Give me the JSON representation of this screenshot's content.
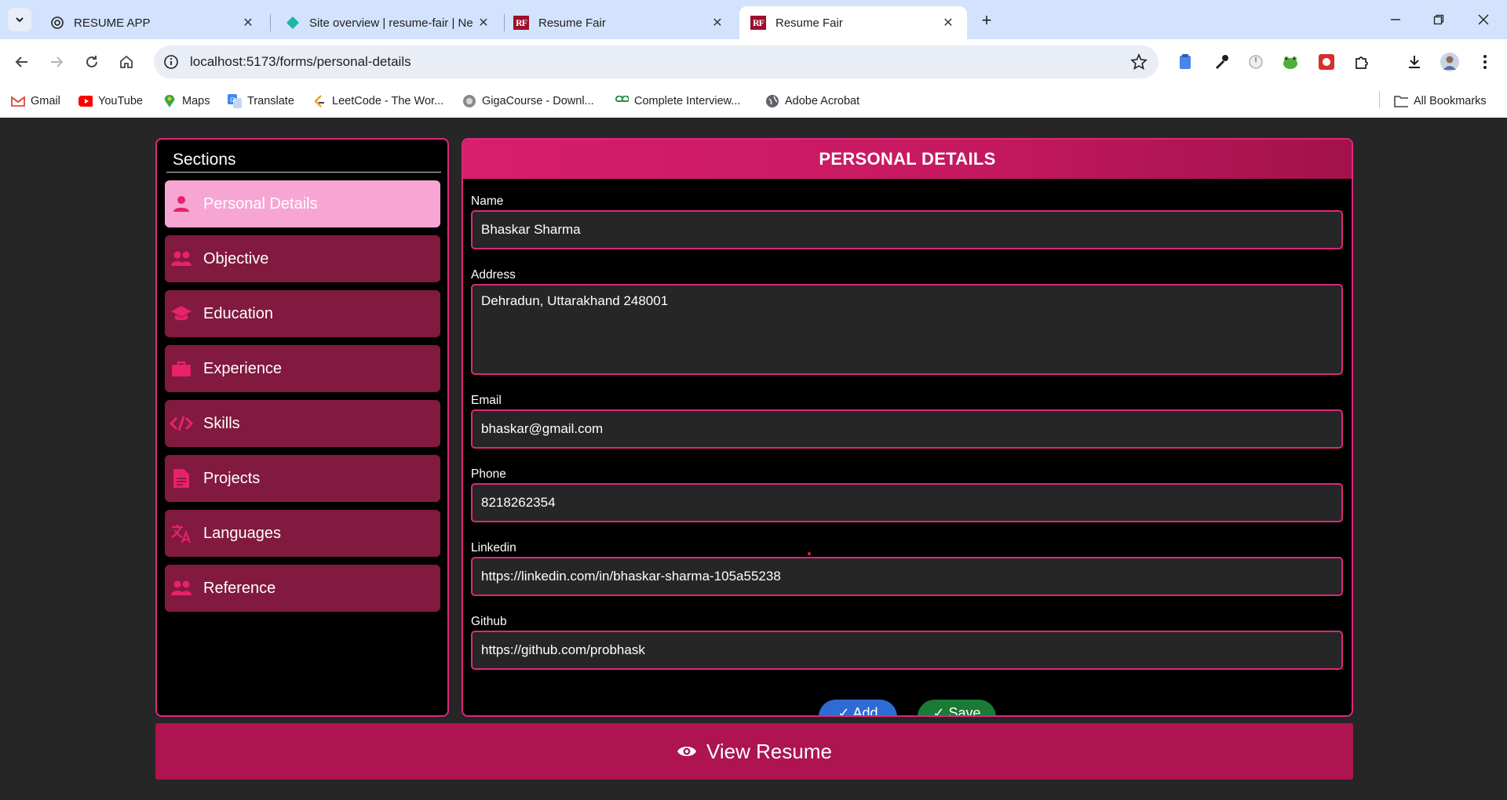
{
  "browser": {
    "tabs": [
      {
        "title": "RESUME APP",
        "active": false
      },
      {
        "title": "Site overview | resume-fair | Ne",
        "active": false
      },
      {
        "title": "Resume Fair",
        "active": false
      },
      {
        "title": "Resume Fair",
        "active": true
      }
    ],
    "url": "localhost:5173/forms/personal-details",
    "bookmarks": [
      {
        "label": "Gmail",
        "icon": "gmail-icon"
      },
      {
        "label": "YouTube",
        "icon": "youtube-icon"
      },
      {
        "label": "Maps",
        "icon": "maps-icon"
      },
      {
        "label": "Translate",
        "icon": "translate-icon"
      },
      {
        "label": "LeetCode - The Wor...",
        "icon": "leetcode-icon"
      },
      {
        "label": "GigaCourse - Downl...",
        "icon": "gigacourse-icon"
      },
      {
        "label": "Complete Interview...",
        "icon": "geeksforgeeks-icon"
      },
      {
        "label": "Adobe Acrobat",
        "icon": "globe-icon"
      }
    ],
    "all_bookmarks": "All Bookmarks"
  },
  "sidebar": {
    "title": "Sections",
    "items": [
      {
        "label": "Personal Details",
        "icon": "person-icon",
        "active": true
      },
      {
        "label": "Objective",
        "icon": "group-icon",
        "active": false
      },
      {
        "label": "Education",
        "icon": "graduation-cap-icon",
        "active": false
      },
      {
        "label": "Experience",
        "icon": "briefcase-icon",
        "active": false
      },
      {
        "label": "Skills",
        "icon": "code-icon",
        "active": false
      },
      {
        "label": "Projects",
        "icon": "document-icon",
        "active": false
      },
      {
        "label": "Languages",
        "icon": "translate-icon",
        "active": false
      },
      {
        "label": "Reference",
        "icon": "group-icon",
        "active": false
      }
    ]
  },
  "form": {
    "title": "PERSONAL DETAILS",
    "fields": {
      "name": {
        "label": "Name",
        "value": "Bhaskar Sharma"
      },
      "address": {
        "label": "Address",
        "value": "Dehradun, Uttarakhand 248001"
      },
      "email": {
        "label": "Email",
        "value": "bhaskar@gmail.com"
      },
      "phone": {
        "label": "Phone",
        "value": "8218262354"
      },
      "linkedin": {
        "label": "Linkedin",
        "value": "https://linkedin.com/in/bhaskar-sharma-105a55238"
      },
      "github": {
        "label": "Github",
        "value": "https://github.com/probhask"
      }
    },
    "add_label": "✓ Add",
    "save_label": "✓ Save"
  },
  "view_resume_label": "View Resume",
  "colors": {
    "accent": "#e0267a",
    "nav_bg": "#82193f",
    "nav_active_bg": "#f7a6d4",
    "icon": "#e8216a",
    "view_button": "#ad1450"
  }
}
